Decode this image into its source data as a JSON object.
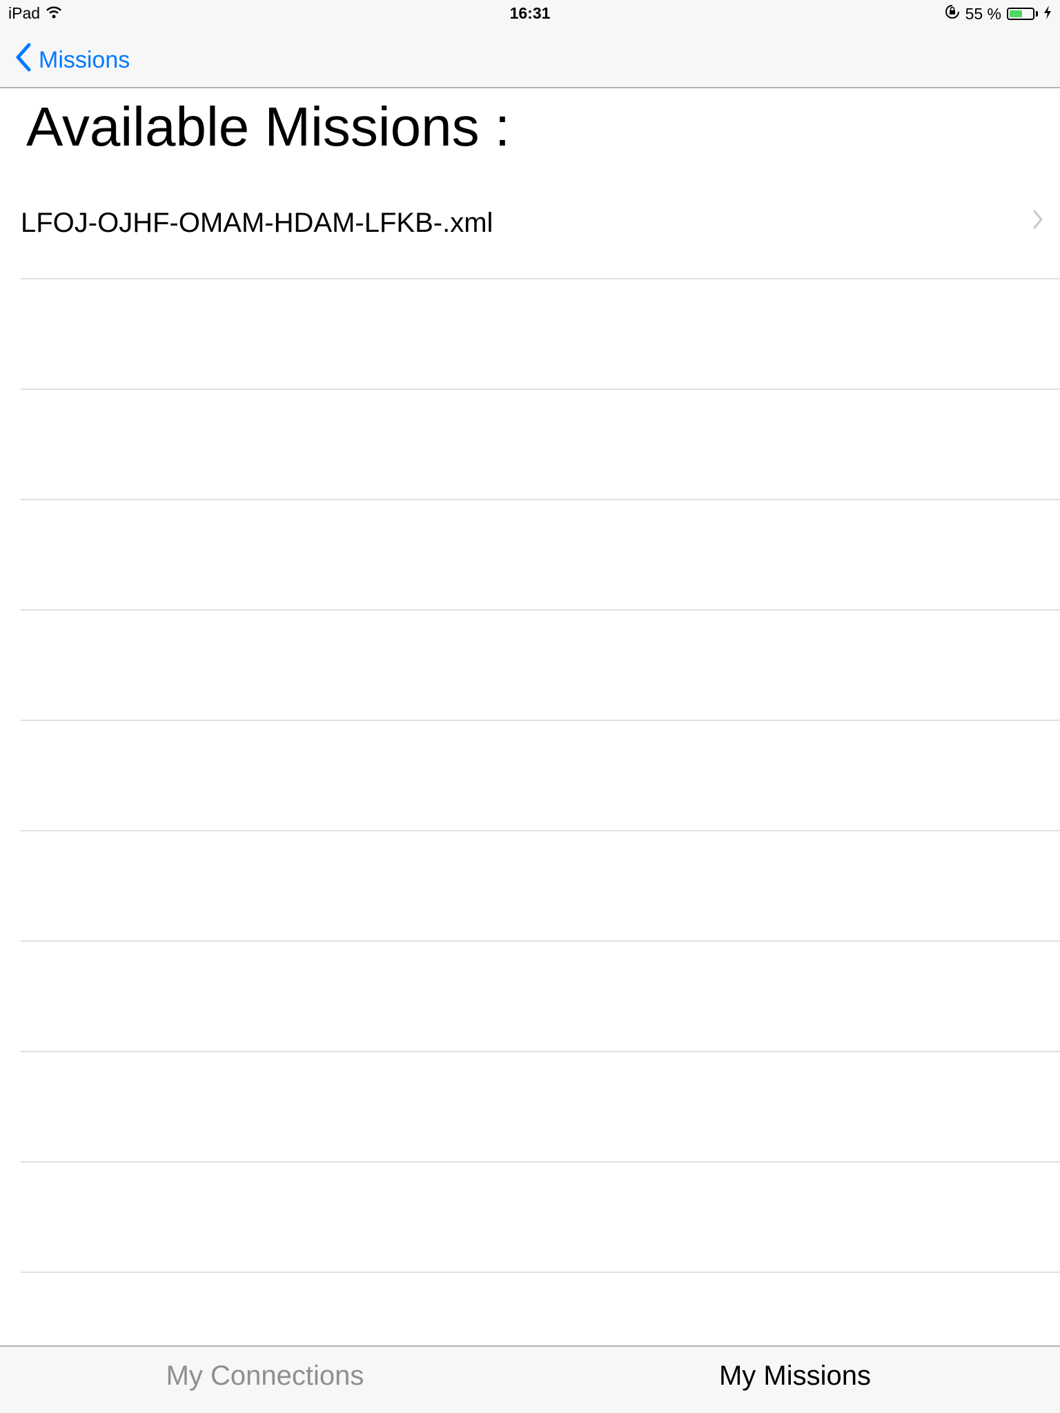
{
  "status_bar": {
    "device": "iPad",
    "time": "16:31",
    "battery_text": "55 %",
    "battery_level": 0.55,
    "icons": [
      "wifi-icon",
      "rotation-lock-icon",
      "battery-icon",
      "charging-bolt-icon"
    ]
  },
  "nav": {
    "back_label": "Missions",
    "accent_color": "#007aff"
  },
  "page": {
    "title": "Available Missions :"
  },
  "missions": [
    {
      "label": "LFOJ-OJHF-OMAM-HDAM-LFKB-.xml"
    },
    {
      "label": ""
    },
    {
      "label": ""
    },
    {
      "label": ""
    },
    {
      "label": ""
    },
    {
      "label": ""
    },
    {
      "label": ""
    },
    {
      "label": ""
    },
    {
      "label": ""
    },
    {
      "label": ""
    }
  ],
  "tabs": [
    {
      "label": "My Connections",
      "selected": false
    },
    {
      "label": "My Missions",
      "selected": true
    }
  ]
}
